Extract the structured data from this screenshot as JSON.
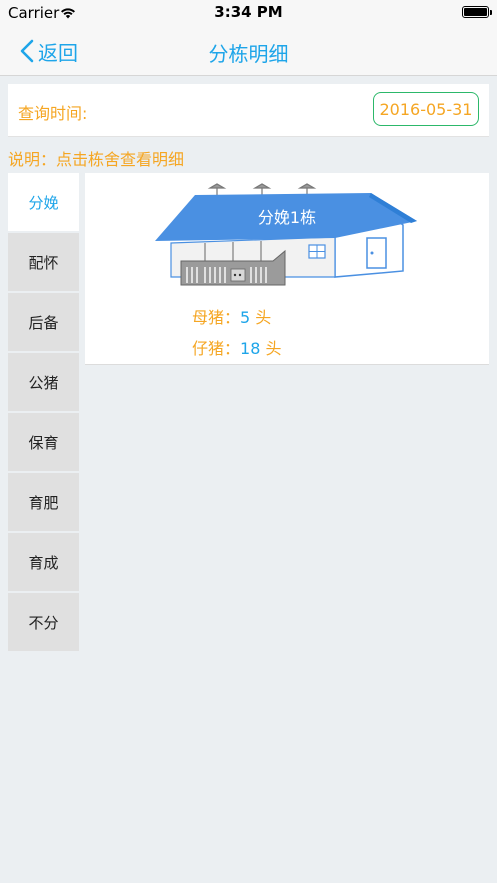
{
  "status_bar": {
    "carrier": "Carrier",
    "time": "3:34 PM"
  },
  "nav": {
    "back_label": "返回",
    "title": "分栋明细"
  },
  "query": {
    "label": "查询时间:",
    "date": "2016-05-31"
  },
  "note": "说明：点击栋舍查看明细",
  "sidebar": {
    "items": [
      {
        "label": "分娩",
        "active": true
      },
      {
        "label": "配怀"
      },
      {
        "label": "后备"
      },
      {
        "label": "公猪"
      },
      {
        "label": "保育"
      },
      {
        "label": "育肥"
      },
      {
        "label": "育成"
      },
      {
        "label": "不分"
      }
    ]
  },
  "barn": {
    "name": "分娩1栋",
    "sow_label": "母猪：",
    "sow_count": "5",
    "piglet_label": "仔猪：",
    "piglet_count": "18",
    "unit": "头"
  },
  "colors": {
    "accent": "#1ea5e9",
    "orange": "#f5a623",
    "green": "#2cb86a",
    "roof": "#4a90e2"
  }
}
